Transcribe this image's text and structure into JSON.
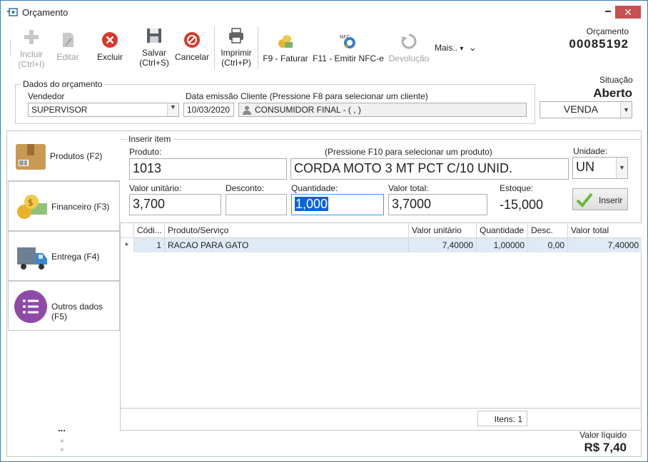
{
  "window": {
    "title": "Orçamento",
    "minimize": "−",
    "close": "✕"
  },
  "toolbar": {
    "incluir": "Incluir",
    "incluir_shortcut": "(Ctrl+I)",
    "editar": "Editar",
    "excluir": "Excluir",
    "salvar": "Salvar",
    "salvar_shortcut": "(Ctrl+S)",
    "cancelar": "Cancelar",
    "imprimir": "Imprimir",
    "imprimir_shortcut": "(Ctrl+P)",
    "faturar": "F9 - Faturar",
    "emitir_nfce": "F11 - Emitir NFC-e",
    "nfc_badge": "NFC",
    "devolucao": "Devolução",
    "mais": "Mais..",
    "mais_arrow": "▾",
    "mais_chevron": "⌄"
  },
  "orcamento": {
    "label": "Orçamento",
    "number": "00085192"
  },
  "situacao": {
    "label": "Situação",
    "value": "Aberto",
    "tipo": "VENDA"
  },
  "dados": {
    "legend": "Dados do orçamento",
    "vendedor_label": "Vendedor",
    "vendedor": "SUPERVISOR",
    "data_label": "Data emissão",
    "data": "10/03/2020",
    "cliente_label": "Cliente (Pressione F8 para selecionar um cliente)",
    "cliente": "CONSUMIDOR FINAL -  ( , )"
  },
  "tabs": [
    {
      "label": "Produtos (F2)"
    },
    {
      "label": "Financeiro (F3)"
    },
    {
      "label": "Entrega (F4)"
    },
    {
      "label": "Outros dados (F5)"
    }
  ],
  "side_more": "...",
  "inserir": {
    "legend": "Inserir item",
    "produto_label": "Produto:",
    "produto_hint": "(Pressione F10 para selecionar um produto)",
    "produto_code": "1013",
    "produto_desc": "CORDA MOTO 3 MT PCT C/10 UNID.",
    "unidade_label": "Unidade:",
    "unidade": "UN",
    "valor_unit_label": "Valor unitário:",
    "valor_unit": "3,700",
    "desconto_label": "Desconto:",
    "desconto": "",
    "quantidade_label": "Quantidade:",
    "quantidade": "1,000",
    "valor_total_label": "Valor total:",
    "valor_total": "3,7000",
    "estoque_label": "Estoque:",
    "estoque": "-15,000",
    "inserir_button": "Inserir"
  },
  "grid": {
    "columns": [
      "Códi...",
      "Produto/Serviço",
      "Valor unitário",
      "Quantidade",
      "Desc.",
      "Valor total"
    ],
    "rows": [
      {
        "codigo": "1",
        "produto": "RACAO PARA GATO",
        "valor_unitario": "7,40000",
        "quantidade": "1,00000",
        "desc": "0,00",
        "valor_total": "7,40000"
      }
    ],
    "row_marker": "▸",
    "itens": "Itens: 1"
  },
  "footer": {
    "valor_liquido_label": "Valor líquido",
    "valor_liquido": "R$ 7,40"
  }
}
